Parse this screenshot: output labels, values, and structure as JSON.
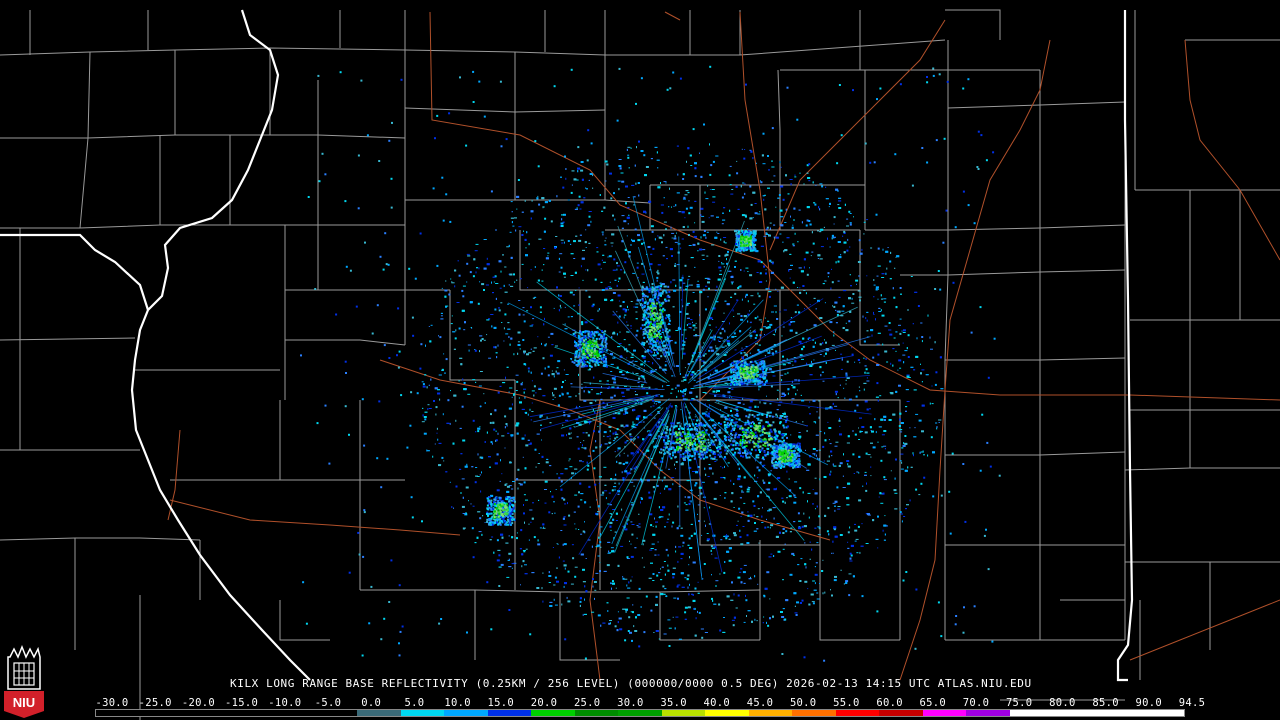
{
  "product": {
    "title": "KILX LONG RANGE BASE REFLECTIVITY (0.25KM / 256 LEVEL) (000000/0000 0.5 DEG) 2026-02-13 14:15 UTC  ATLAS.NIU.EDU"
  },
  "color_scale": {
    "labels": [
      "-30.0",
      "-25.0",
      "-20.0",
      "-15.0",
      "-10.0",
      "-5.0",
      "0.0",
      "5.0",
      "10.0",
      "15.0",
      "20.0",
      "25.0",
      "30.0",
      "35.0",
      "40.0",
      "45.0",
      "50.0",
      "55.0",
      "60.0",
      "65.0",
      "70.0",
      "75.0",
      "80.0",
      "85.0",
      "90.0",
      "94.5"
    ],
    "colors": [
      "#000000",
      "#000000",
      "#000000",
      "#000000",
      "#000000",
      "#000000",
      "#3a6a78",
      "#00d8f0",
      "#00a8ff",
      "#0030e8",
      "#00d000",
      "#008c00",
      "#00a000",
      "#b8e000",
      "#ffff00",
      "#ffb000",
      "#ff7000",
      "#ff0000",
      "#c80000",
      "#ff00ff",
      "#a000e0",
      "#ffffff",
      "#ffffff",
      "#ffffff",
      "#ffffff"
    ]
  },
  "logo": {
    "text": "NIU"
  },
  "map": {
    "radar_site": "KILX",
    "state_border_color": "#ffffff",
    "county_line_color": "#9a9a9a",
    "highway_color": "#b0502a",
    "echo_colors": [
      "#00d8f0",
      "#00a8ff",
      "#2a7fff",
      "#38b8d0",
      "#0030e8"
    ],
    "strong_echo_colors": [
      "#00d000",
      "#3cd84c",
      "#80e070"
    ]
  }
}
